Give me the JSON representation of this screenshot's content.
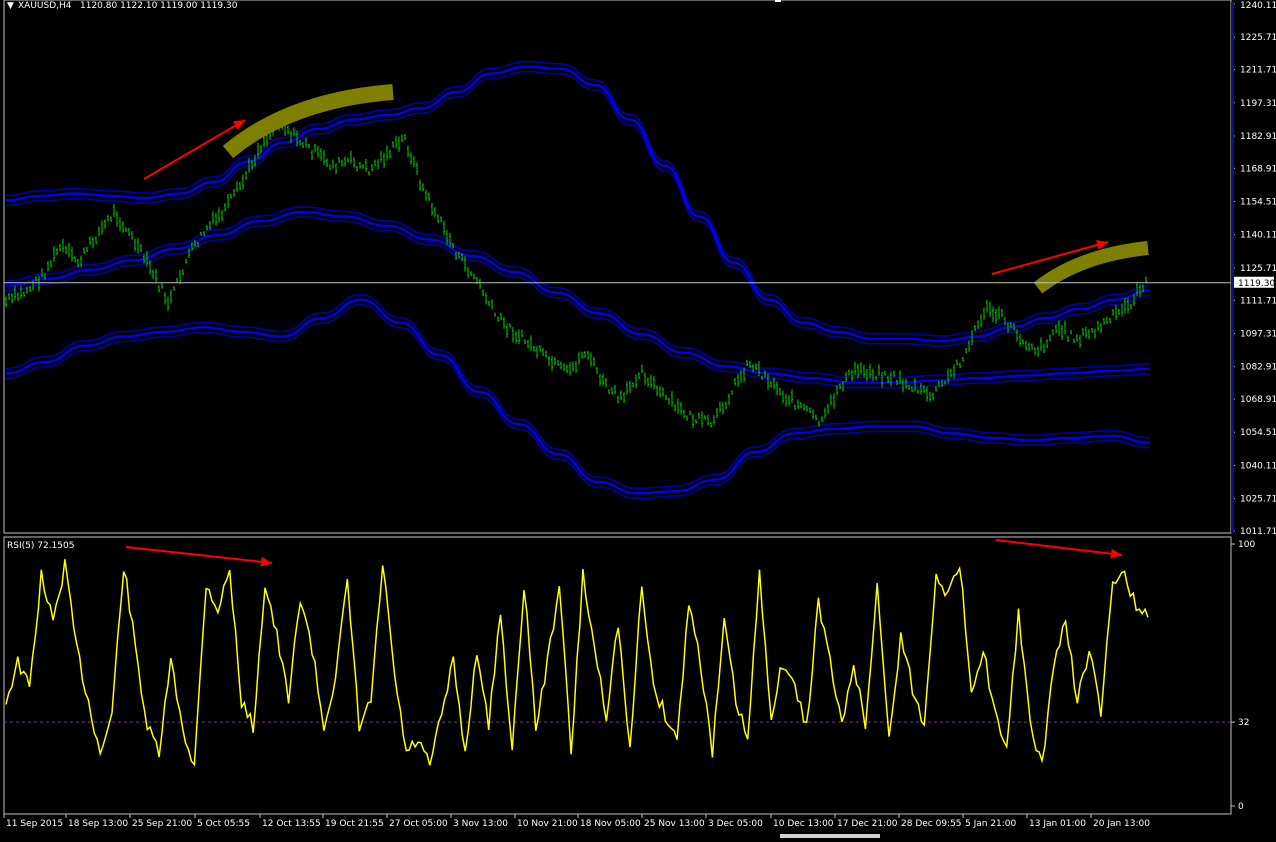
{
  "header": {
    "symbol": "XAUUSD,H4",
    "ohlc": "1120.80 1122.10 1119.00 1119.30",
    "menu_icon": "triangle-down-icon"
  },
  "current_price": "1119.30",
  "rsi_header": "RSI(5) 72.1505",
  "colors": {
    "background": "#000000",
    "frame": "#c0c0c0",
    "candles": "#00cc00",
    "bands": "#0000cc",
    "rsi": "#ffff00",
    "arrows": "#ff0000",
    "highlight": "#808000",
    "scrollbar": "#101080"
  },
  "chart_data": [
    {
      "type": "line",
      "title": "XAUUSD,H4",
      "yticks": [
        "1240.11",
        "1225.71",
        "1211.71",
        "1197.31",
        "1182.91",
        "1168.91",
        "1154.51",
        "1140.11",
        "1125.71",
        "1111.71",
        "1097.31",
        "1082.91",
        "1068.91",
        "1054.51",
        "1040.11",
        "1025.71",
        "1011.71"
      ],
      "ylim": [
        1011.71,
        1240.11
      ],
      "xlabels": [
        "11 Sep 2015",
        "18 Sep 13:00",
        "25 Sep 21:00",
        "5 Oct 05:55",
        "12 Oct 13:55",
        "19 Oct 21:55",
        "27 Oct 05:00",
        "3 Nov 13:00",
        "10 Nov 21:00",
        "18 Nov 05:00",
        "25 Nov 13:00",
        "3 Dec 05:00",
        "10 Dec 13:00",
        "17 Dec 21:00",
        "28 Dec 09:55",
        "5 Jan 21:00",
        "13 Jan 01:00",
        "20 Jan 13:00"
      ],
      "series": [
        {
          "values": [
            1111,
            1115,
            1122,
            1135,
            1128,
            1140,
            1150,
            1138,
            1125,
            1110,
            1130,
            1142,
            1150,
            1162,
            1178,
            1190,
            1182,
            1176,
            1170,
            1172,
            1168,
            1175,
            1182,
            1160,
            1145,
            1130,
            1120,
            1105,
            1098,
            1092,
            1085,
            1080,
            1090,
            1075,
            1068,
            1082,
            1072,
            1065,
            1060,
            1058,
            1072,
            1085,
            1078,
            1070,
            1065,
            1058,
            1075,
            1082,
            1080,
            1078,
            1074,
            1070,
            1078,
            1090,
            1108,
            1104,
            1095,
            1090,
            1100,
            1095,
            1098,
            1104,
            1110,
            1122
          ]
        },
        {
          "values": [
            1155,
            1157,
            1158,
            1157,
            1156,
            1158,
            1163,
            1172,
            1180,
            1186,
            1190,
            1192,
            1195,
            1202,
            1210,
            1213,
            1212,
            1205,
            1190,
            1170,
            1148,
            1128,
            1112,
            1102,
            1098,
            1095,
            1095,
            1094,
            1096,
            1100,
            1104,
            1108,
            1112,
            1116
          ]
        },
        {
          "values": [
            1118,
            1121,
            1125,
            1129,
            1134,
            1140,
            1146,
            1150,
            1148,
            1144,
            1138,
            1131,
            1124,
            1115,
            1106,
            1097,
            1089,
            1083,
            1080,
            1078,
            1076,
            1076,
            1077,
            1078,
            1079,
            1080,
            1081,
            1082
          ]
        },
        {
          "values": [
            1080,
            1085,
            1092,
            1096,
            1098,
            1100,
            1098,
            1096,
            1104,
            1112,
            1102,
            1088,
            1072,
            1058,
            1045,
            1033,
            1028,
            1029,
            1034,
            1046,
            1054,
            1056,
            1057,
            1057,
            1054,
            1052,
            1051,
            1052,
            1053,
            1050
          ]
        }
      ]
    },
    {
      "type": "line",
      "title": "RSI(5) 72.1505",
      "yticks": [
        "100",
        "32",
        "0"
      ],
      "ylim": [
        0,
        100
      ],
      "levels": [
        32
      ],
      "series": [
        {
          "values": [
            40,
            55,
            45,
            88,
            70,
            92,
            60,
            40,
            20,
            35,
            92,
            60,
            30,
            20,
            55,
            30,
            15,
            85,
            75,
            90,
            40,
            30,
            85,
            65,
            40,
            80,
            60,
            30,
            50,
            85,
            30,
            40,
            92,
            50,
            20,
            25,
            15,
            35,
            55,
            20,
            60,
            30,
            75,
            20,
            85,
            30,
            55,
            85,
            20,
            88,
            60,
            35,
            70,
            20,
            85,
            45,
            35,
            25,
            78,
            55,
            20,
            70,
            40,
            25,
            88,
            35,
            55,
            45,
            30,
            78,
            55,
            30,
            55,
            30,
            85,
            25,
            65,
            45,
            30,
            90,
            80,
            92,
            45,
            60,
            35,
            20,
            75,
            30,
            15,
            55,
            70,
            40,
            60,
            35,
            85,
            90,
            75,
            72
          ]
        }
      ]
    }
  ]
}
